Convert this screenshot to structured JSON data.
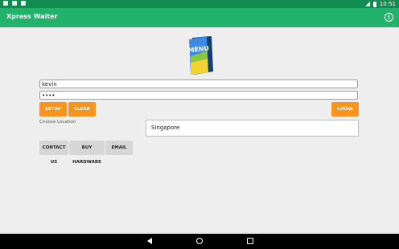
{
  "status_bar": {
    "time": "10:51"
  },
  "app_bar": {
    "title": "Xpress Waiter",
    "info_icon": "info-icon"
  },
  "logo": {
    "text": "MENU",
    "icon": "menu-book-icon"
  },
  "login": {
    "username_value": "kevin",
    "password_value": "••••"
  },
  "buttons": {
    "setup": "SETUP",
    "clear": "CLEAR",
    "login": "LOGIN",
    "contact_us": "CONTACT US",
    "buy_hardware": "BUY HARDWARE",
    "email": "EMAIL"
  },
  "location": {
    "label": "Choose Location",
    "selected": "Singapore"
  },
  "colors": {
    "status_bar": "#138a50",
    "app_bar": "#21b36b",
    "accent_orange": "#f7941d",
    "button_grey": "#d6d6d6",
    "background": "#eeeeee"
  }
}
